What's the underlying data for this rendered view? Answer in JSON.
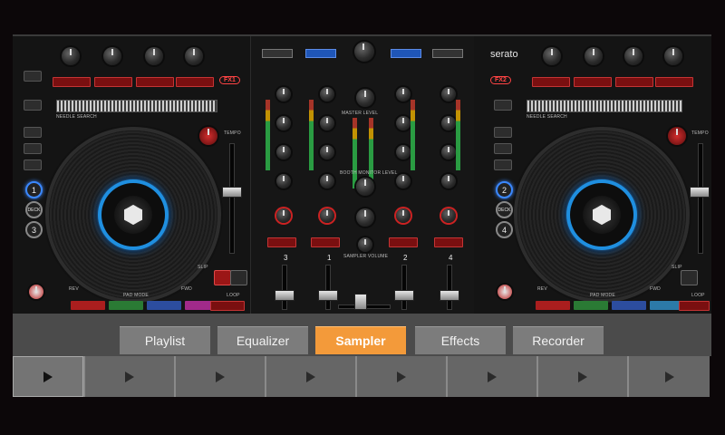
{
  "app": {
    "brand": "serato"
  },
  "mixer": {
    "fx_labels": [
      "FX1",
      "FX2"
    ],
    "channel_numbers": [
      "3",
      "1",
      "2",
      "4"
    ],
    "center_labels": [
      "MASTER LEVEL",
      "BOOTH MONITOR LEVEL",
      "SAMPLER VOLUME"
    ]
  },
  "decks": {
    "left": {
      "numbers": [
        "1",
        "DECK",
        "3"
      ],
      "labels": [
        "NEEDLE SEARCH",
        "PAD MODE",
        "LOOP",
        "TEMPO",
        "REV",
        "FWD",
        "SLIP"
      ]
    },
    "right": {
      "numbers": [
        "2",
        "DECK",
        "4"
      ],
      "labels": [
        "NEEDLE SEARCH",
        "PAD MODE",
        "LOOP",
        "TEMPO",
        "REV",
        "FWD",
        "SLIP"
      ]
    }
  },
  "tabs": [
    {
      "label": "Playlist",
      "active": false
    },
    {
      "label": "Equalizer",
      "active": false
    },
    {
      "label": "Sampler",
      "active": true
    },
    {
      "label": "Effects",
      "active": false
    },
    {
      "label": "Recorder",
      "active": false
    }
  ],
  "sampler_slots": [
    {
      "icon": "play-icon",
      "active": true
    },
    {
      "icon": "play-icon",
      "active": false
    },
    {
      "icon": "play-icon",
      "active": false
    },
    {
      "icon": "play-icon",
      "active": false
    },
    {
      "icon": "play-icon",
      "active": false
    },
    {
      "icon": "play-icon",
      "active": false
    },
    {
      "icon": "play-icon",
      "active": false
    },
    {
      "icon": "play-icon",
      "active": false
    }
  ],
  "colors": {
    "accent": "#f39a3a",
    "tab_bg": "#7c7c7c",
    "bar_bg": "#4b4b4b",
    "jog_ring": "#1f8fe0"
  }
}
